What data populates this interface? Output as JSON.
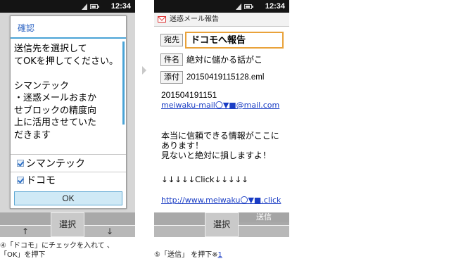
{
  "status_bar": {
    "time": "12:34"
  },
  "phone1": {
    "dialog": {
      "title": "確認",
      "message": "送信先を選択して\nてOKを押してください。\n\nシマンテック\n・迷惑メールおまか\nせブロックの精度向\n上に活用させていた\nだきます",
      "options": [
        "シマンテック",
        "ドコモ"
      ],
      "ok_label": "OK"
    },
    "softkeys": {
      "left": "↑",
      "center": "選択",
      "right": "↓"
    }
  },
  "phone2": {
    "subbar_title": "迷惑メール報告",
    "to_label": "宛先",
    "to_value": "ドコモへ報告",
    "subject_label": "件名",
    "subject_value": "絶対に儲かる話がこ",
    "attachment_label": "添付",
    "attachment_value": "20150419115128.eml",
    "body": {
      "line_number": "201504191151",
      "sender_link": "meiwaku-mail〇▼■@mail.com",
      "message": "本当に信頼できる情報がここにあります！\n見ないと絶対に損しますよ！",
      "arrows": "↓↓↓↓↓Click↓↓↓↓↓",
      "url_link": "http://www.meiwaku〇▼■.click"
    },
    "softkeys": {
      "center": "選択",
      "right": "送信"
    }
  },
  "captions": {
    "step4": "④「ドコモ」にチェックを入れて 、\n「OK」を押下",
    "step5": "⑤「送信」 を押下※",
    "step5_note": "1"
  }
}
